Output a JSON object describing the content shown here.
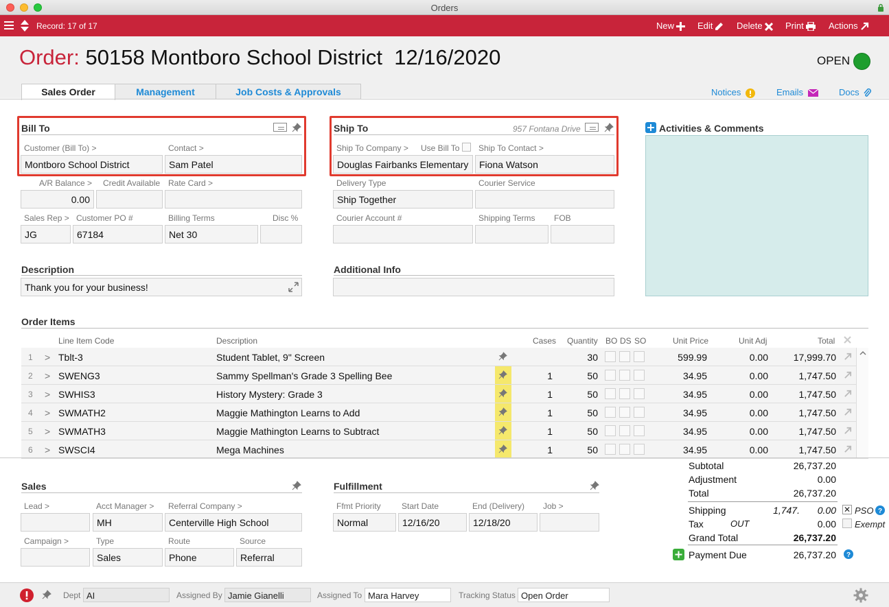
{
  "window": {
    "title": "Orders"
  },
  "toolbar": {
    "record": "Record: 17 of 17",
    "new": "New",
    "edit": "Edit",
    "delete": "Delete",
    "print": "Print",
    "actions": "Actions"
  },
  "header": {
    "label": "Order:",
    "title": "50158 Montboro School District  12/16/2020",
    "status": "OPEN",
    "status_color": "#1e9e2e"
  },
  "tabs": [
    "Sales Order",
    "Management",
    "Job Costs & Approvals"
  ],
  "header_links": {
    "notices": "Notices",
    "emails": "Emails",
    "docs": "Docs"
  },
  "bill_to": {
    "title": "Bill To",
    "customer_label": "Customer (Bill To) >",
    "customer": "Montboro School District",
    "contact_label": "Contact >",
    "contact": "Sam Patel"
  },
  "ship_to": {
    "title": "Ship To",
    "address": "957 Fontana Drive",
    "company_label": "Ship To Company >",
    "use_bill_to": "Use Bill To",
    "company": "Douglas Fairbanks Elementary",
    "contact_label": "Ship To Contact >",
    "contact": "Fiona Watson"
  },
  "activities": {
    "title": "Activities & Comments"
  },
  "billing": {
    "ar_label": "A/R Balance >",
    "ar": "0.00",
    "credit_label": "Credit Available",
    "credit": "",
    "rate_label": "Rate Card >",
    "rate": "",
    "rep_label": "Sales Rep >",
    "rep": "JG",
    "po_label": "Customer PO #",
    "po": "67184",
    "terms_label": "Billing Terms",
    "terms": "Net 30",
    "disc_label": "Disc %",
    "disc": ""
  },
  "delivery": {
    "type_label": "Delivery Type",
    "type": "Ship Together",
    "courier_label": "Courier Service",
    "courier": "",
    "account_label": "Courier Account #",
    "account": "",
    "terms_label": "Shipping Terms",
    "terms": "",
    "fob_label": "FOB",
    "fob": ""
  },
  "description": {
    "title": "Description",
    "value": "Thank you for your business!"
  },
  "additional": {
    "title": "Additional Info",
    "value": ""
  },
  "order_items": {
    "title": "Order Items",
    "headers": {
      "code": "Line Item Code",
      "desc": "Description",
      "cases": "Cases",
      "qty": "Quantity",
      "bo": "BO",
      "ds": "DS",
      "so": "SO",
      "price": "Unit Price",
      "adj": "Unit Adj",
      "total": "Total"
    },
    "rows": [
      {
        "n": "1",
        "code": "Tblt-3",
        "desc": "Student Tablet, 9\" Screen",
        "cases": "",
        "qty": "30",
        "price": "599.99",
        "adj": "0.00",
        "total": "17,999.70",
        "pinned": false
      },
      {
        "n": "2",
        "code": "SWENG3",
        "desc": "Sammy Spellman's Grade 3 Spelling Bee",
        "cases": "1",
        "qty": "50",
        "price": "34.95",
        "adj": "0.00",
        "total": "1,747.50",
        "pinned": true
      },
      {
        "n": "3",
        "code": "SWHIS3",
        "desc": "History Mystery: Grade 3",
        "cases": "1",
        "qty": "50",
        "price": "34.95",
        "adj": "0.00",
        "total": "1,747.50",
        "pinned": true
      },
      {
        "n": "4",
        "code": "SWMATH2",
        "desc": "Maggie Mathington Learns to Add",
        "cases": "1",
        "qty": "50",
        "price": "34.95",
        "adj": "0.00",
        "total": "1,747.50",
        "pinned": true
      },
      {
        "n": "5",
        "code": "SWMATH3",
        "desc": "Maggie Mathington Learns to Subtract",
        "cases": "1",
        "qty": "50",
        "price": "34.95",
        "adj": "0.00",
        "total": "1,747.50",
        "pinned": true
      },
      {
        "n": "6",
        "code": "SWSCI4",
        "desc": "Mega Machines",
        "cases": "1",
        "qty": "50",
        "price": "34.95",
        "adj": "0.00",
        "total": "1,747.50",
        "pinned": true
      }
    ]
  },
  "sales": {
    "title": "Sales",
    "lead_label": "Lead >",
    "lead": "",
    "acct_label": "Acct Manager >",
    "acct": "MH",
    "referral_label": "Referral Company >",
    "referral": "Centerville High School",
    "campaign_label": "Campaign >",
    "campaign": "",
    "type_label": "Type",
    "type": "Sales",
    "route_label": "Route",
    "route": "Phone",
    "source_label": "Source",
    "source": "Referral"
  },
  "fulfillment": {
    "title": "Fulfillment",
    "priority_label": "Ffmt Priority",
    "priority": "Normal",
    "start_label": "Start Date",
    "start": "12/16/20",
    "end_label": "End (Delivery)",
    "end": "12/18/20",
    "job_label": "Job >",
    "job": ""
  },
  "totals": {
    "subtotal_label": "Subtotal",
    "subtotal": "26,737.20",
    "adjustment_label": "Adjustment",
    "adjustment": "0.00",
    "total_label": "Total",
    "total": "26,737.20",
    "shipping_label": "Shipping",
    "shipping_est": "1,747.",
    "shipping": "0.00",
    "pso": "PSO",
    "tax_label": "Tax",
    "tax_code": "OUT",
    "tax": "0.00",
    "exempt": "Exempt",
    "grand_label": "Grand Total",
    "grand": "26,737.20",
    "due_label": "Payment Due",
    "due": "26,737.20"
  },
  "footer": {
    "dept_label": "Dept",
    "dept": "AI",
    "assigned_by_label": "Assigned By",
    "assigned_by": "Jamie Gianelli",
    "assigned_to_label": "Assigned To",
    "assigned_to": "Mara Harvey",
    "tracking_label": "Tracking Status",
    "tracking": "Open Order"
  }
}
